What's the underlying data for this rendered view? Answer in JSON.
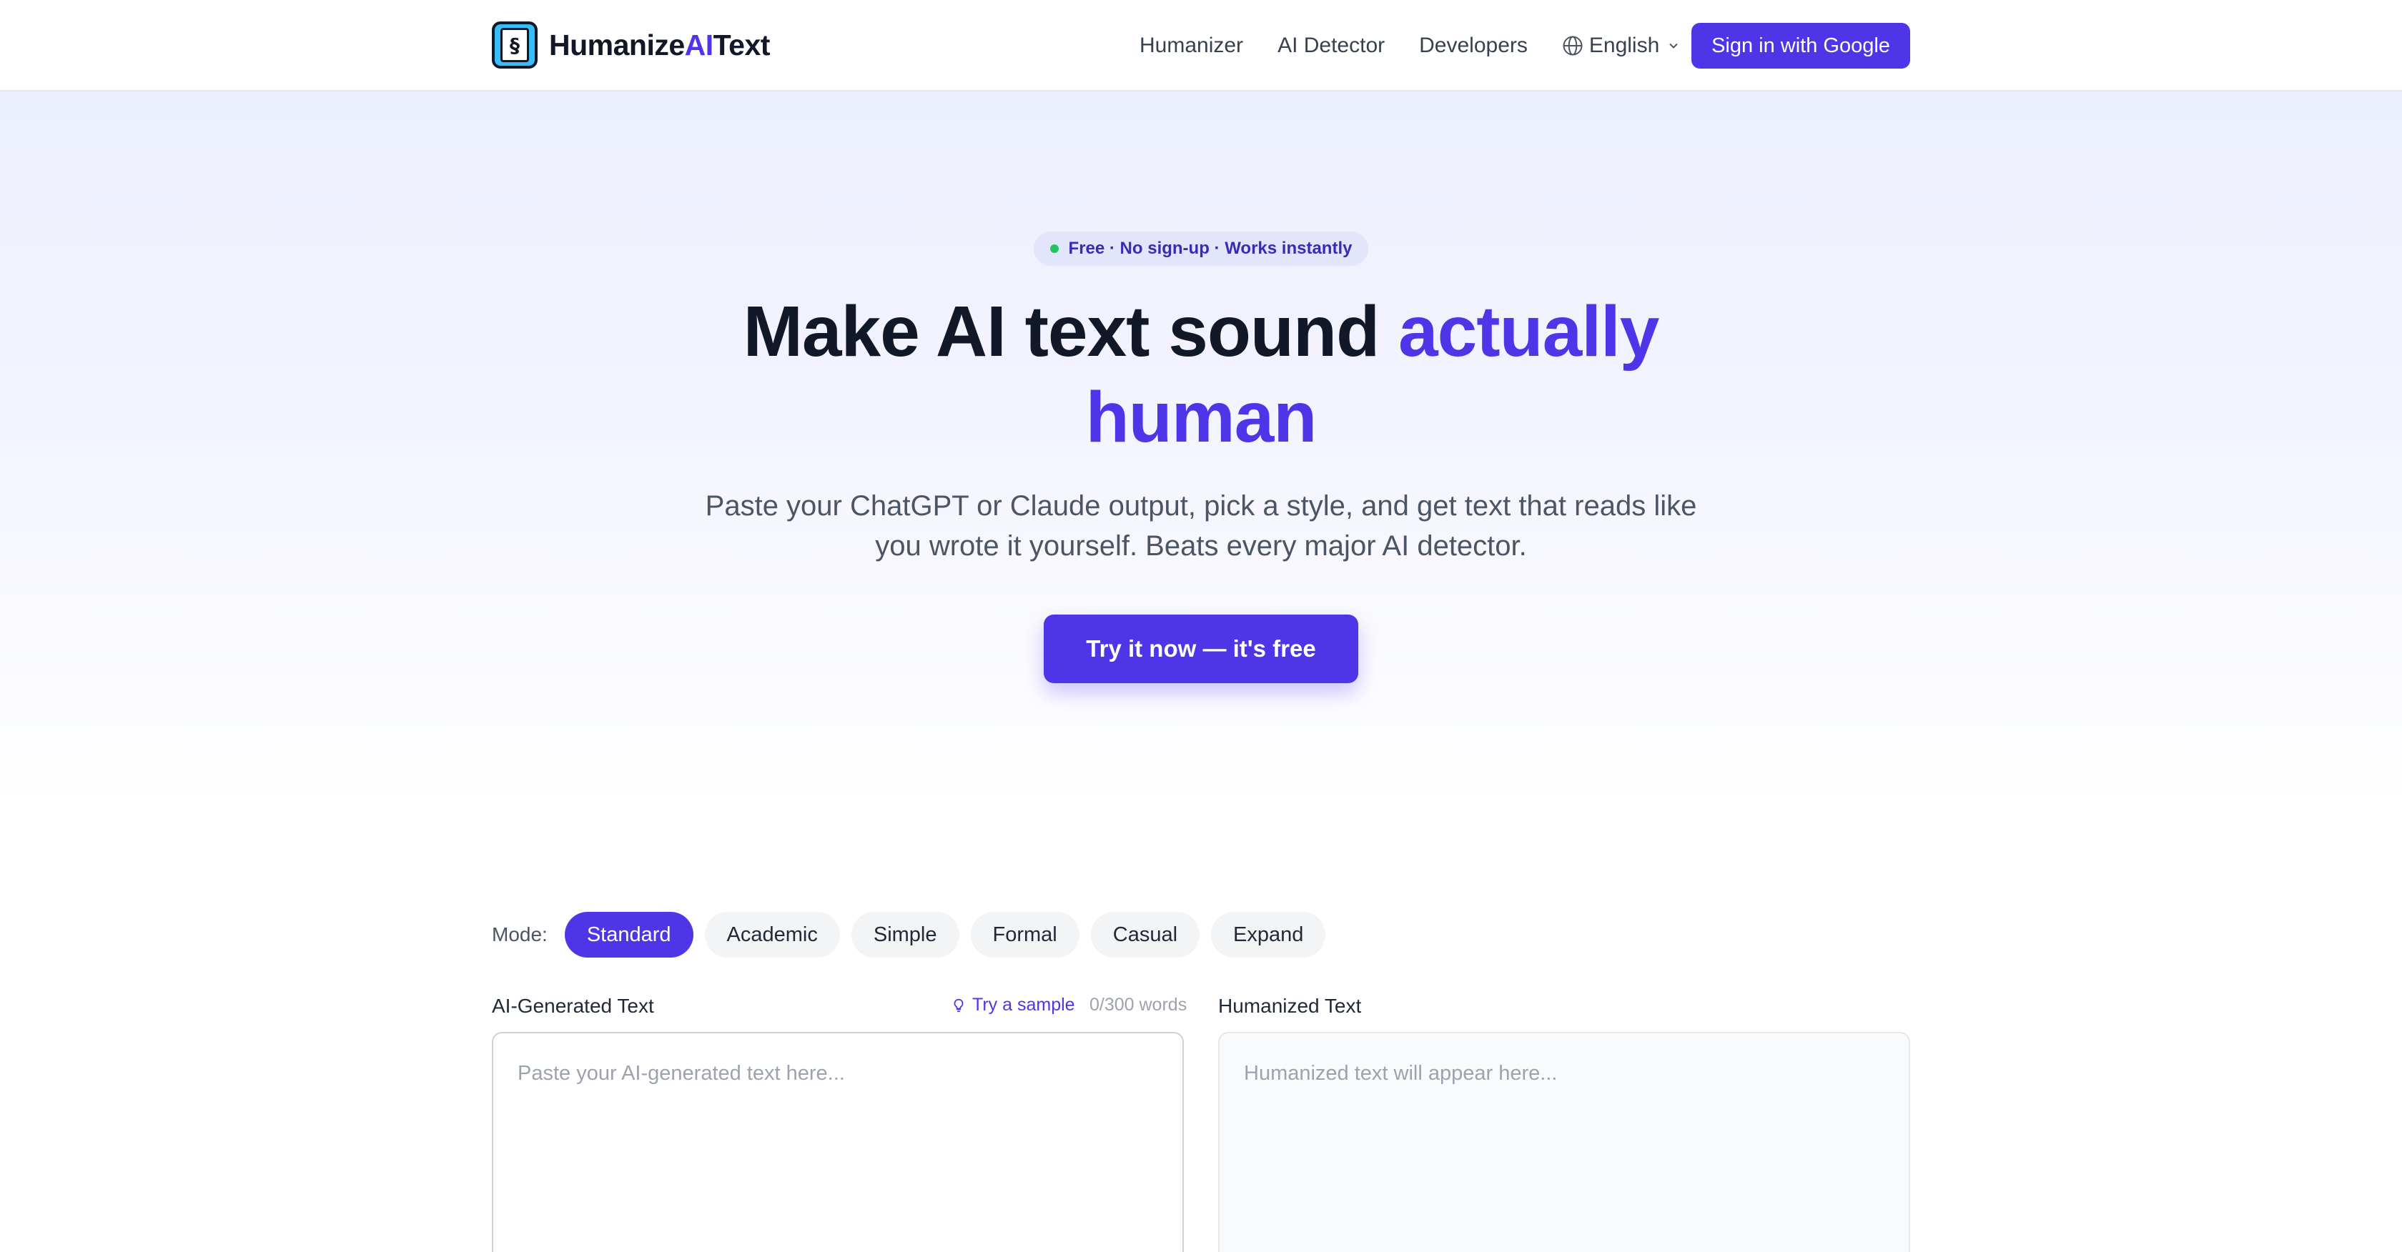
{
  "header": {
    "brand": {
      "part1": "Humanize",
      "part2": "AI",
      "part3": "Text"
    },
    "nav": [
      {
        "label": "Humanizer"
      },
      {
        "label": "AI Detector"
      },
      {
        "label": "Developers"
      }
    ],
    "language": "English",
    "signin_label": "Sign in with Google"
  },
  "hero": {
    "badge": "Free · No sign-up · Works instantly",
    "headline_plain": "Make AI text sound ",
    "headline_accent_1": "actually",
    "headline_accent_2": "human",
    "subhead": "Paste your ChatGPT or Claude output, pick a style, and get text that reads like you wrote it yourself. Beats every major AI detector.",
    "cta_label": "Try it now — it's free"
  },
  "modes": {
    "label": "Mode:",
    "items": [
      {
        "label": "Standard",
        "active": true
      },
      {
        "label": "Academic",
        "active": false
      },
      {
        "label": "Simple",
        "active": false
      },
      {
        "label": "Formal",
        "active": false
      },
      {
        "label": "Casual",
        "active": false
      },
      {
        "label": "Expand",
        "active": false
      }
    ]
  },
  "input_panel": {
    "label": "AI-Generated Text",
    "sample_label": "Try a sample",
    "word_count": "0/300 words",
    "placeholder": "Paste your AI-generated text here..."
  },
  "output_panel": {
    "label": "Humanized Text",
    "placeholder": "Humanized text will appear here..."
  },
  "colors": {
    "accent": "#4f35e8",
    "status_dot": "#22c55e",
    "hero_bg_top": "#eceffd"
  }
}
